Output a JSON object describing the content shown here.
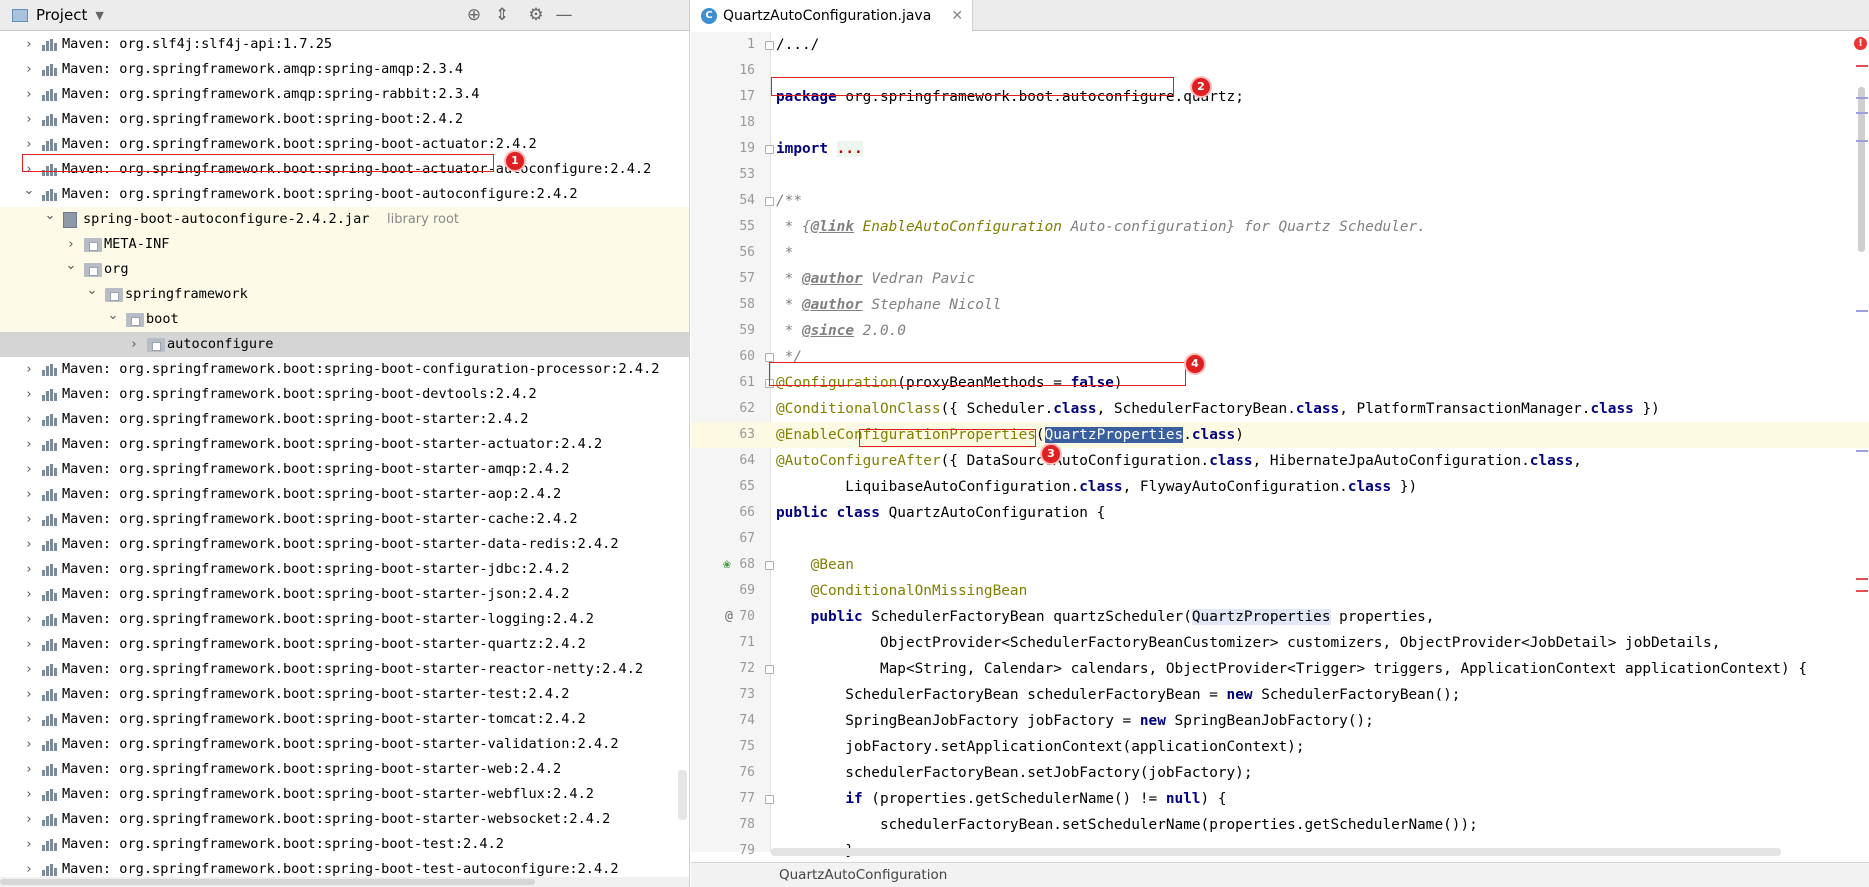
{
  "project": {
    "title": "Project",
    "tree": [
      {
        "label": "Maven: org.slf4j:slf4j-api:1.7.25"
      },
      {
        "label": "Maven: org.springframework.amqp:spring-amqp:2.3.4"
      },
      {
        "label": "Maven: org.springframework.amqp:spring-rabbit:2.3.4"
      },
      {
        "label": "Maven: org.springframework.boot:spring-boot:2.4.2"
      },
      {
        "label": "Maven: org.springframework.boot:spring-boot-actuator:2.4.2"
      },
      {
        "label": "Maven: org.springframework.boot:spring-boot-actuator-autoconfigure:2.4.2"
      },
      {
        "label": "Maven: org.springframework.boot:spring-boot-autoconfigure:2.4.2"
      },
      {
        "label": "spring-boot-autoconfigure-2.4.2.jar",
        "hint": "library root"
      },
      {
        "label": "META-INF"
      },
      {
        "label": "org"
      },
      {
        "label": "springframework"
      },
      {
        "label": "boot"
      },
      {
        "label": "autoconfigure"
      },
      {
        "label": "Maven: org.springframework.boot:spring-boot-configuration-processor:2.4.2"
      },
      {
        "label": "Maven: org.springframework.boot:spring-boot-devtools:2.4.2"
      },
      {
        "label": "Maven: org.springframework.boot:spring-boot-starter:2.4.2"
      },
      {
        "label": "Maven: org.springframework.boot:spring-boot-starter-actuator:2.4.2"
      },
      {
        "label": "Maven: org.springframework.boot:spring-boot-starter-amqp:2.4.2"
      },
      {
        "label": "Maven: org.springframework.boot:spring-boot-starter-aop:2.4.2"
      },
      {
        "label": "Maven: org.springframework.boot:spring-boot-starter-cache:2.4.2"
      },
      {
        "label": "Maven: org.springframework.boot:spring-boot-starter-data-redis:2.4.2"
      },
      {
        "label": "Maven: org.springframework.boot:spring-boot-starter-jdbc:2.4.2"
      },
      {
        "label": "Maven: org.springframework.boot:spring-boot-starter-json:2.4.2"
      },
      {
        "label": "Maven: org.springframework.boot:spring-boot-starter-logging:2.4.2"
      },
      {
        "label": "Maven: org.springframework.boot:spring-boot-starter-quartz:2.4.2"
      },
      {
        "label": "Maven: org.springframework.boot:spring-boot-starter-reactor-netty:2.4.2"
      },
      {
        "label": "Maven: org.springframework.boot:spring-boot-starter-test:2.4.2"
      },
      {
        "label": "Maven: org.springframework.boot:spring-boot-starter-tomcat:2.4.2"
      },
      {
        "label": "Maven: org.springframework.boot:spring-boot-starter-validation:2.4.2"
      },
      {
        "label": "Maven: org.springframework.boot:spring-boot-starter-web:2.4.2"
      },
      {
        "label": "Maven: org.springframework.boot:spring-boot-starter-webflux:2.4.2"
      },
      {
        "label": "Maven: org.springframework.boot:spring-boot-starter-websocket:2.4.2"
      },
      {
        "label": "Maven: org.springframework.boot:spring-boot-test:2.4.2"
      },
      {
        "label": "Maven: org.springframework.boot:spring-boot-test-autoconfigure:2.4.2"
      }
    ]
  },
  "editor": {
    "tab_label": "QuartzAutoConfiguration.java",
    "status_breadcrumb": "QuartzAutoConfiguration",
    "line_numbers": [
      "1",
      "16",
      "17",
      "18",
      "19",
      "53",
      "54",
      "55",
      "56",
      "57",
      "58",
      "59",
      "60",
      "61",
      "62",
      "63",
      "64",
      "65",
      "66",
      "67",
      "68",
      "69",
      "70",
      "71",
      "72",
      "73",
      "74",
      "75",
      "76",
      "77",
      "78",
      "79"
    ],
    "code": {
      "l1": "/.../",
      "l17_kw": "package",
      "l17_rest": " org.springframework.boot.autoconfigure.quartz;",
      "l19_kw": "import",
      "l19_dots": "...",
      "l54": "/**",
      "l55_a": " * {",
      "l55_tag": "@link",
      "l55_link": " EnableAutoConfiguration",
      "l55_b": " Auto-configuration} for Quartz Scheduler.",
      "l56": " *",
      "l57_a": " * ",
      "l57_tag": "@author",
      "l57_b": " Vedran Pavic",
      "l58_a": " * ",
      "l58_tag": "@author",
      "l58_b": " Stephane Nicoll",
      "l59_a": " * ",
      "l59_tag": "@since",
      "l59_b": " 2.0.0",
      "l60": " */",
      "l61_an": "@Configuration",
      "l61_a": "(proxyBeanMethods = ",
      "l61_kw": "false",
      "l61_b": ")",
      "l62_an": "@ConditionalOnClass",
      "l62_a": "({ Scheduler.",
      "l62_k1": "class",
      "l62_b": ", SchedulerFactoryBean.",
      "l62_k2": "class",
      "l62_c": ", PlatformTransactionManager.",
      "l62_k3": "class",
      "l62_d": " })",
      "l63_an": "@EnableConfigurationProperties",
      "l63_a": "(",
      "l63_sel1": "Quartz",
      "l63_sel2": "Properties",
      "l63_dot": ".",
      "l63_kw": "class",
      "l63_b": ")",
      "l64_an": "@AutoConfigureAfter",
      "l64_a": "({ DataSourceAutoConfiguration.",
      "l64_k1": "class",
      "l64_b": ", HibernateJpaAutoConfiguration.",
      "l64_k2": "class",
      "l64_c": ",",
      "l65_a": "        LiquibaseAutoConfiguration.",
      "l65_k1": "class",
      "l65_b": ", FlywayAutoConfiguration.",
      "l65_k2": "class",
      "l65_c": " })",
      "l66_kw": "public class",
      "l66_a": " ",
      "l66_name": "QuartzAutoConfiguration",
      "l66_b": " {",
      "l68_an": "    @Bean",
      "l69_an": "    @ConditionalOnMissingBean",
      "l70_ind": "    ",
      "l70_kw": "public",
      "l70_a": " SchedulerFactoryBean quartzScheduler(",
      "l70_hl": "QuartzProperties",
      "l70_b": " properties,",
      "l71": "            ObjectProvider<SchedulerFactoryBeanCustomizer> customizers, ObjectProvider<JobDetail> jobDetails,",
      "l72": "            Map<String, Calendar> calendars, ObjectProvider<Trigger> triggers, ApplicationContext applicationContext) {",
      "l73_a": "        SchedulerFactoryBean schedulerFactoryBean = ",
      "l73_kw": "new",
      "l73_b": " SchedulerFactoryBean();",
      "l74_a": "        SpringBeanJobFactory jobFactory = ",
      "l74_kw": "new",
      "l74_b": " SpringBeanJobFactory();",
      "l75": "        jobFactory.setApplicationContext(applicationContext);",
      "l76": "        schedulerFactoryBean.setJobFactory(jobFactory);",
      "l77_ind": "        ",
      "l77_kw": "if",
      "l77_a": " (properties.getSchedulerName() != ",
      "l77_kw2": "null",
      "l77_b": ") {",
      "l78": "            schedulerFactoryBean.setSchedulerName(properties.getSchedulerName());",
      "l79": "        }"
    }
  },
  "annotations": [
    "1",
    "2",
    "3",
    "4"
  ],
  "error_marker": "!",
  "colors": {
    "highlight_box": "#e02020",
    "keyword": "#000080",
    "annotation": "#808000"
  }
}
